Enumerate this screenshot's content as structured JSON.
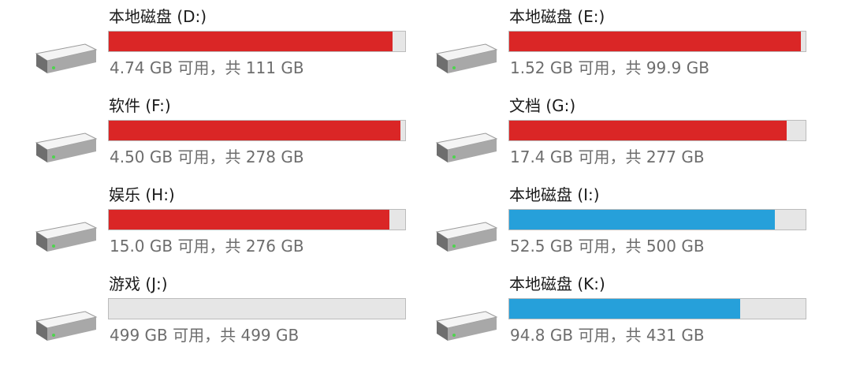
{
  "colors": {
    "critical": "#da2626",
    "normal": "#26a0da",
    "track": "#e6e6e6"
  },
  "drives": [
    {
      "name": "本地磁盘 (D:)",
      "info": "4.74 GB 可用，共 111 GB",
      "used_fraction": 0.957,
      "status": "critical",
      "icon": "hard-drive-icon"
    },
    {
      "name": "本地磁盘 (E:)",
      "info": "1.52 GB 可用，共 99.9 GB",
      "used_fraction": 0.985,
      "status": "critical",
      "icon": "hard-drive-icon"
    },
    {
      "name": "软件 (F:)",
      "info": "4.50 GB 可用，共 278 GB",
      "used_fraction": 0.984,
      "status": "critical",
      "icon": "hard-drive-icon"
    },
    {
      "name": "文档 (G:)",
      "info": "17.4 GB 可用，共 277 GB",
      "used_fraction": 0.937,
      "status": "critical",
      "icon": "hard-drive-icon"
    },
    {
      "name": "娱乐 (H:)",
      "info": "15.0 GB 可用，共 276 GB",
      "used_fraction": 0.946,
      "status": "critical",
      "icon": "hard-drive-icon"
    },
    {
      "name": "本地磁盘 (I:)",
      "info": "52.5 GB 可用，共 500 GB",
      "used_fraction": 0.895,
      "status": "normal",
      "icon": "hard-drive-icon"
    },
    {
      "name": "游戏 (J:)",
      "info": "499 GB 可用，共 499 GB",
      "used_fraction": 0.0,
      "status": "normal",
      "icon": "hard-drive-icon"
    },
    {
      "name": "本地磁盘 (K:)",
      "info": "94.8 GB 可用，共 431 GB",
      "used_fraction": 0.78,
      "status": "normal",
      "icon": "hard-drive-icon"
    }
  ]
}
